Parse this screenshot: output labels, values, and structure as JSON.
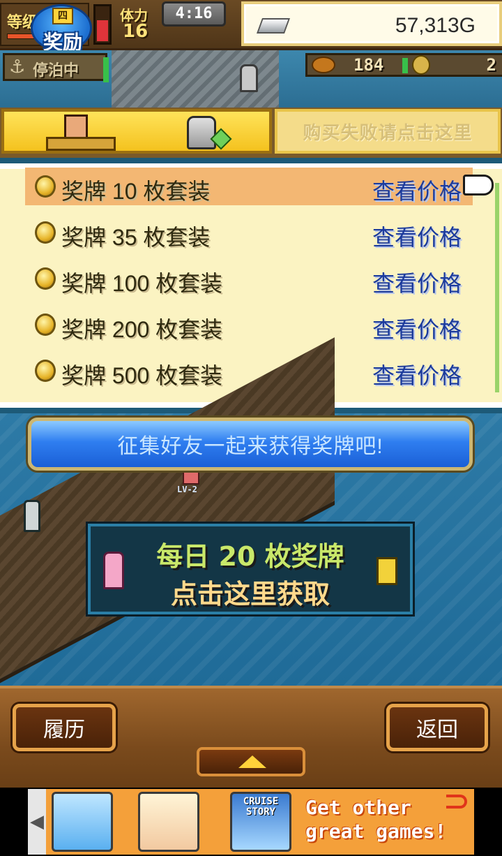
{
  "hud": {
    "level_label": "等级",
    "reward_mini": "四",
    "reward_label": "奖励",
    "stamina_label": "体力",
    "stamina_value": "16",
    "clock": "4:16",
    "gold": "57,313G"
  },
  "status": {
    "docked_label": "停泊中",
    "food_count": "184",
    "medal_count": "2"
  },
  "tabs": {
    "purchase_failed_label": "购买失败请点击这里"
  },
  "packages": [
    {
      "name": "奖牌 10 枚套装",
      "action": "查看价格"
    },
    {
      "name": "奖牌 35 枚套装",
      "action": "查看价格"
    },
    {
      "name": "奖牌 100 枚套装",
      "action": "查看价格"
    },
    {
      "name": "奖牌 200 枚套装",
      "action": "查看价格"
    },
    {
      "name": "奖牌 500 枚套装",
      "action": "查看价格"
    }
  ],
  "invite": {
    "text": "征集好友一起来获得奖牌吧!"
  },
  "daily": {
    "line1": "每日 20 枚奖牌",
    "line2": "点击这里获取"
  },
  "scene": {
    "lv_tag": "LV-2"
  },
  "nav": {
    "history_label": "履历",
    "back_label": "返回"
  },
  "ad": {
    "cruise_label": "CRUISE STORY",
    "cta": "Get other great games!"
  },
  "colors": {
    "list_bg": "#fbf3c2",
    "selected_row": "#f3b773",
    "price_link": "#1c3b9c",
    "banner_blue": "#2f7ef0"
  }
}
